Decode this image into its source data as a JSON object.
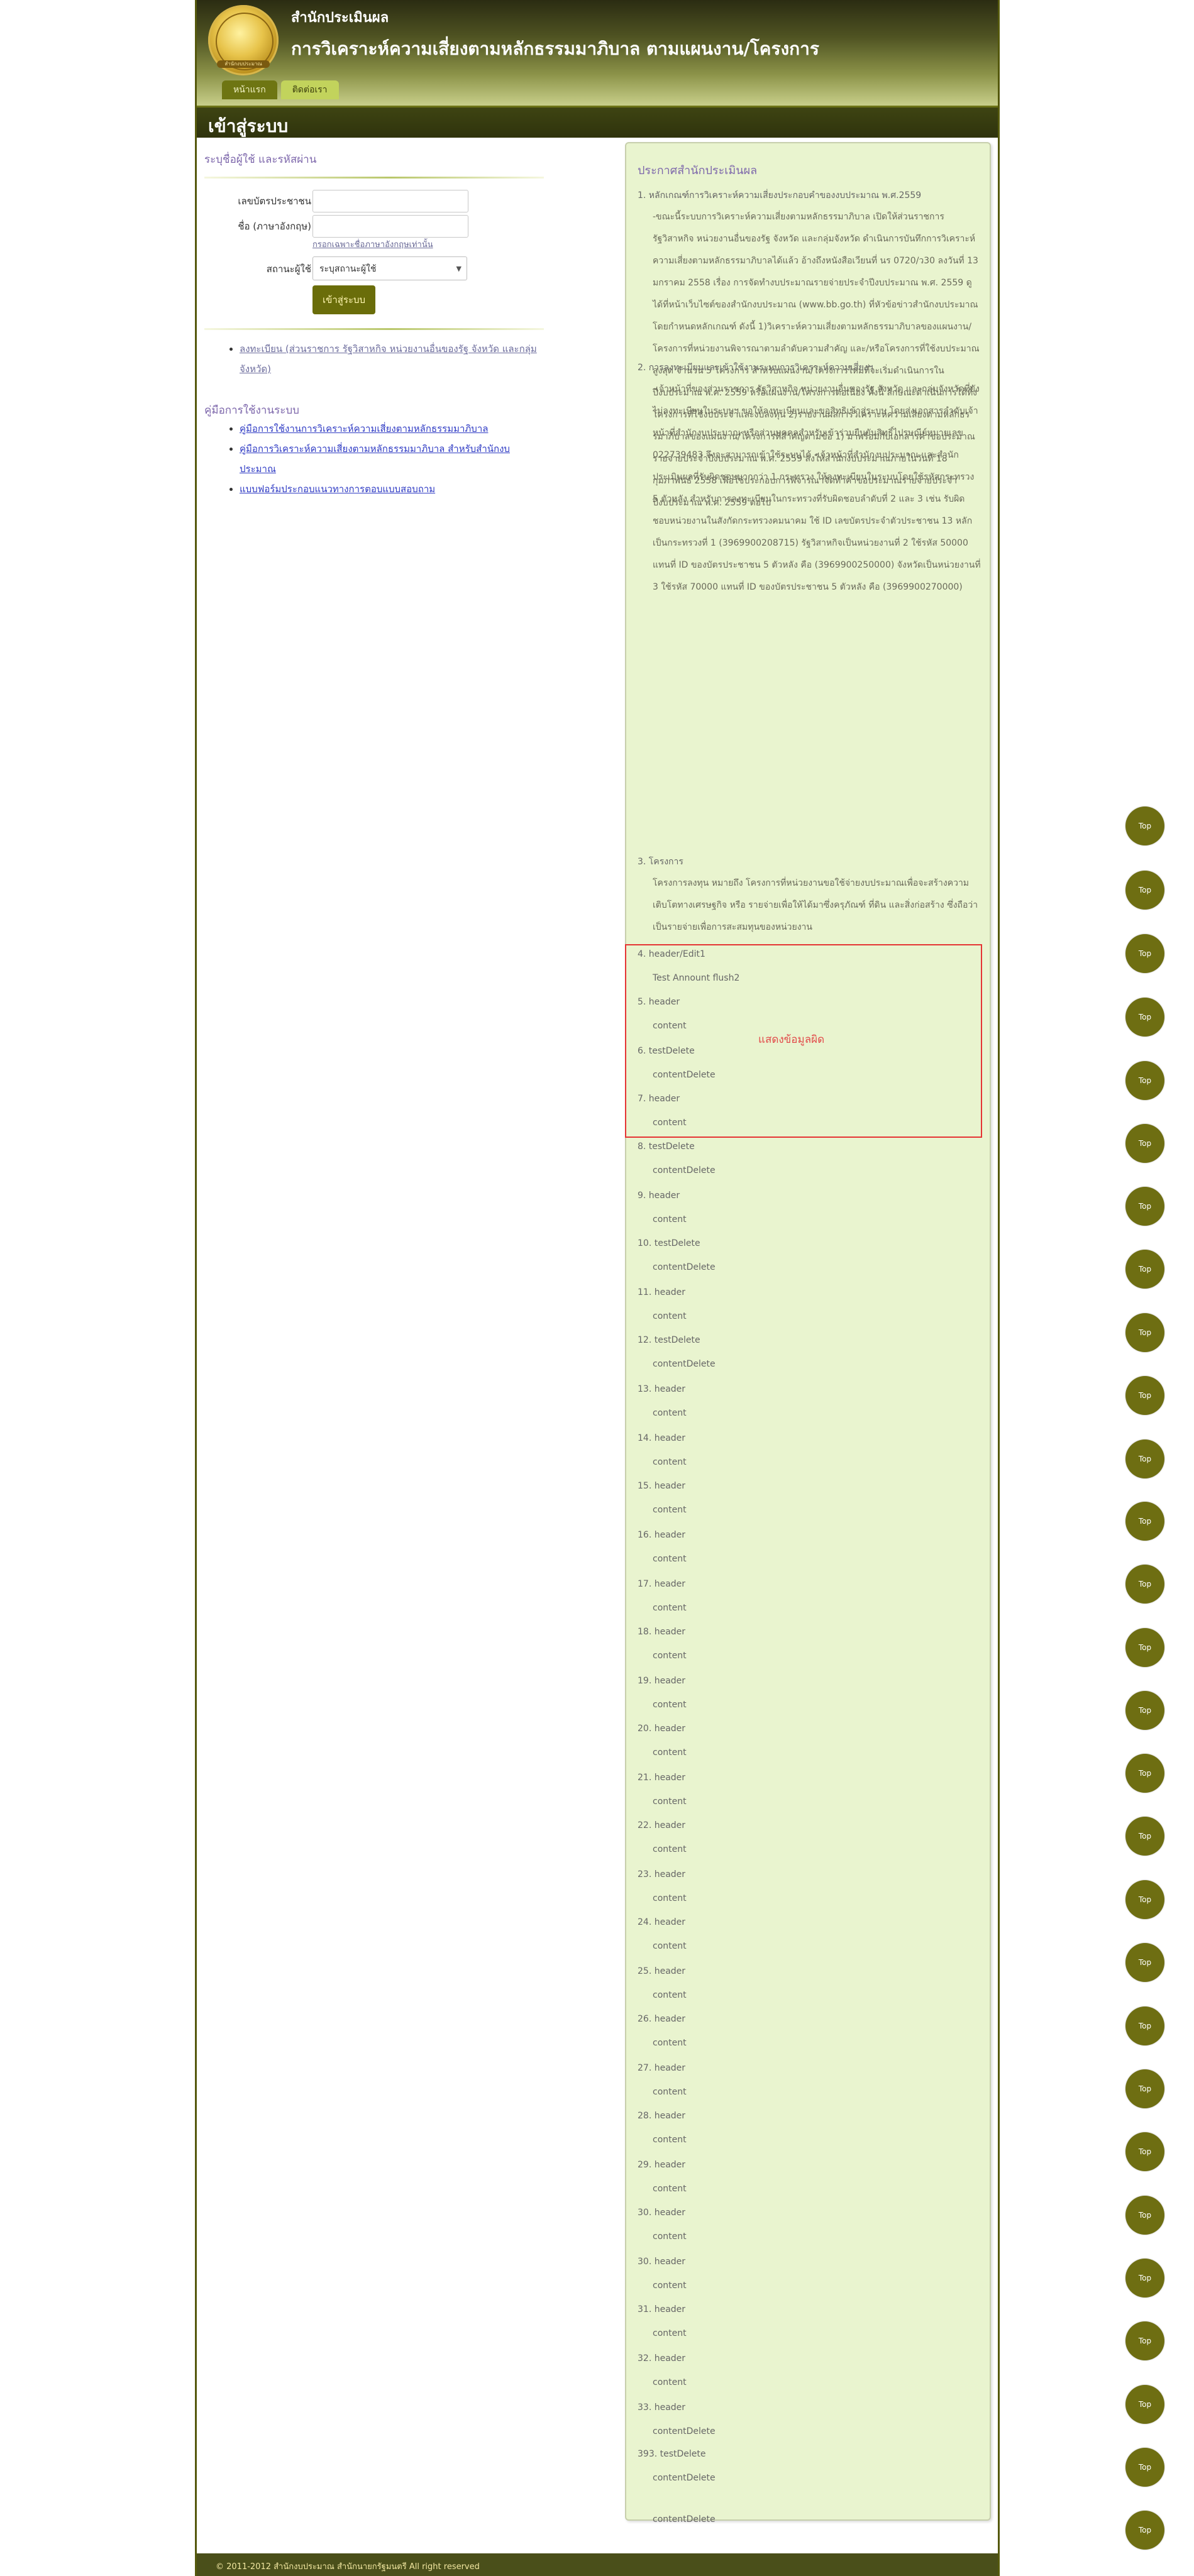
{
  "header": {
    "office_name": "สำนักประเมินผล",
    "system_title": "การวิเคราะห์ความเสี่ยงตามหลักธรรมมาภิบาล ตามแผนงาน/โครงการ",
    "logo_text": "สำนักงบประมาณ"
  },
  "nav": {
    "home": "หน้าแรก",
    "contact": "ติดต่อเรา"
  },
  "login_bar": {
    "label": "เข้าสู่ระบบ"
  },
  "login": {
    "heading": "ระบุชื่อผู้ใช้ และรหัสผ่าน",
    "id_label": "เลขบัตรประชาชน",
    "name_label": "ชื่อ (ภาษาอังกฤษ)",
    "name_hint": "กรอกเฉพาะชื่อภาษาอังกฤษเท่านั้น",
    "status_label": "สถานะผู้ใช้",
    "status_value": "ระบุสถานะผู้ใช้",
    "submit_label": "เข้าสู่ระบบ"
  },
  "register_links": [
    "ลงทะเบียน (ส่วนราชการ รัฐวิสาหกิจ หน่วยงานอื่นของรัฐ จังหวัด และกลุ่มจังหวัด)"
  ],
  "manual": {
    "heading": "คู่มือการใช้งานระบบ",
    "links": [
      "คู่มือการใช้งานการวิเคราะห์ความเสี่ยงตามหลักธรรมมาภิบาล",
      "คู่มือการวิเคราะห์ความเสี่ยงตามหลักธรรมมาภิบาล สำหรับสำนักงบประมาณ",
      "แบบฟอร์มประกอบแนวทางการตอบแบบสอบถาม"
    ]
  },
  "announcements": {
    "title": "ประกาศสำนักประเมินผล",
    "error_text": "แสดงข้อมูลผิด",
    "items": [
      {
        "title": "1. หลักเกณฑ์การวิเคราะห์ความเสี่ยงประกอบคำของงบประมาณ พ.ศ.2559",
        "content": "-ขณะนี้ระบบการวิเคราะห์ความเสี่ยงตามหลักธรรมาภิบาล เปิดให้ส่วนราชการ รัฐวิสาหกิจ หน่วยงานอื่นของรัฐ จังหวัด และกลุ่มจังหวัด ดำเนินการบันทึกการวิเคราะห์ความเสี่ยงตามหลักธรรมาภิบาลได้แล้ว อ้างถึงหนังสือเวียนที่ นร 0720/ว30 ลงวันที่ 13 มกราคม 2558 เรื่อง การจัดทำงบประมาณรายจ่ายประจำปีงบประมาณ พ.ศ. 2559 ดูได้ที่หน้าเว็บไซต์ของสำนักงบประมาณ (www.bb.go.th) ที่หัวข้อข่าวสำนักงบประมาณ โดยกำหนดหลักเกณฑ์ ดังนี้ 1)วิเคราะห์ความเสี่ยงตามหลักธรรมาภิบาลของแผนงาน/โครงการที่หน่วยงานพิจารณาตามลำดับความสำคัญ และ/หรือโครงการที่ใช้งบประมาณสูงสุด จำนวน 5 โครงการ สำหรับแผนงาน/โครงการใหม่ที่จะเริ่มดำเนินการในปีงบประมาณ พ.ศ. 2559 หรือแผนงาน/โครงการต่อเนื่อง ทั้งนี้ ลักษณะดำเนินการได้ทั้งโครงการที่ใช้งบประจำและงบลงทุน 2)รายงานผลการวิเคราะห์ความเสี่ยงตามหลักธรรมาภิบาลของแผนงาน/โครงการที่สำคัญตามข้อ 1) มาพร้อมกับเอกสารคำขอประมาณรายจ่ายประจำปีงบประมาณ พ.ศ. 2559 ส่งให้สำนักงบประมาณภายในวันที่ 18 กุมภาพันธ์ 2558 เพื่อใช้ประกอบการพิจารณาจัดทำคำขอประมาณรายจ่ายประจำปีงบประมาณ พ.ศ. 2559 ต่อไป"
      },
      {
        "title": "2. การลงทะเบียนและเข้าใช้งานระบบการวิเคราะห์ความเสี่ยงฯ",
        "content": "-เจ้าหน้าที่ของส่วนราชการ รัฐวิสาหกิจ หน่วยงานอื่นของรัฐ จังหวัด และกลุ่มจังหวัดที่ยังไม่ลงทะเบียนในระบบฯ ขอให้ลงทะเบียนและขอสิทธิเข้าสู่ระบบ โดยส่งเอกสารลำดับเจ้าหน้าที่สำนักงบประมาณ หรือส่วนบุคคลสำหรับเข้าร่วมยืนยันสิทธิ์ไปรษณีย์หมายเลข 022739483 จึงจะสามารถเข้าใช้ระบบได้ -เจ้าหน้าที่สำนักงบประมาณ และสำนักประเมินผลที่รับผิดชอบมากกว่า 1 กระทรวง ให้ลงทะเบียนในระบบโดยใช้รหัสกระทรวง 5 ตัวหลัง สำหรับการลงทะเบียนในกระทรวงที่รับผิดชอบลำดับที่ 2 และ 3 เช่น รับผิดชอบหน่วยงานในสังกัดกระทรวงคมนาคม ใช้ ID เลขบัตรประจำตัวประชาชน 13 หลัก เป็นกระทรวงที่ 1 (3969900208715) รัฐวิสาหกิจเป็นหน่วยงานที่ 2 ใช้รหัส 50000 แทนที่ ID ของบัตรประชาชน 5 ตัวหลัง คือ (3969900250000) จังหวัดเป็นหน่วยงานที่ 3 ใช้รหัส 70000 แทนที่ ID ของบัตรประชาชน 5 ตัวหลัง คือ (3969900270000)"
      },
      {
        "title": "3. โครงการ",
        "content": "โครงการลงทุน หมายถึง โครงการที่หน่วยงานขอใช้จ่ายงบประมาณเพื่อจะสร้างความเติบโตทางเศรษฐกิจ หรือ รายจ่ายเพื่อให้ได้มาซึ่งครุภัณฑ์ ที่ดิน และสิ่งก่อสร้าง ซึ่งถือว่าเป็นรายจ่ายเพื่อการสะสมทุนของหน่วยงาน"
      },
      {
        "title": "4. header/Edit1",
        "content": "Test Annount flush2"
      },
      {
        "title": "5. header",
        "content": "content"
      },
      {
        "title": "6. testDelete",
        "content": "contentDelete"
      },
      {
        "title": "7. header",
        "content": "content"
      },
      {
        "title": "8. testDelete",
        "content": "contentDelete"
      },
      {
        "title": "9. header",
        "content": "content"
      },
      {
        "title": "10. testDelete",
        "content": "contentDelete"
      },
      {
        "title": "11. header",
        "content": "content"
      },
      {
        "title": "12. testDelete",
        "content": "contentDelete"
      },
      {
        "title": "13. header",
        "content": "content"
      },
      {
        "title": "14. header",
        "content": "content"
      },
      {
        "title": "15. header",
        "content": "content"
      },
      {
        "title": "16. header",
        "content": "content"
      },
      {
        "title": "17. header",
        "content": "content"
      },
      {
        "title": "18. header",
        "content": "content"
      },
      {
        "title": "19. header",
        "content": "content"
      },
      {
        "title": "20. header",
        "content": "content"
      },
      {
        "title": "21. header",
        "content": "content"
      },
      {
        "title": "22. header",
        "content": "content"
      },
      {
        "title": "23. header",
        "content": "content"
      },
      {
        "title": "24. header",
        "content": "content"
      },
      {
        "title": "25. header",
        "content": "content"
      },
      {
        "title": "26. header",
        "content": "content"
      },
      {
        "title": "27. header",
        "content": "content"
      },
      {
        "title": "28. header",
        "content": "content"
      },
      {
        "title": "29. header",
        "content": "content"
      },
      {
        "title": "30. header",
        "content": "content"
      },
      {
        "title": "30. header",
        "content": "content"
      },
      {
        "title": "31. header",
        "content": "content"
      },
      {
        "title": "32. header",
        "content": "content"
      },
      {
        "title": "33. header",
        "content": "contentDelete"
      },
      {
        "title": "393. testDelete",
        "content": "contentDelete"
      },
      {
        "title": "",
        "content": "contentDelete"
      }
    ]
  },
  "top_button_label": "Top",
  "footer": {
    "text": "© 2011-2012 สำนักงบประมาณ สำนักนายกรัฐมนตรี All right reserved"
  },
  "colors": {
    "olive": "#6e6e12",
    "panel_bg": "#e9f4cf",
    "error_red": "#e53434",
    "heading_purple": "#7d67ab"
  }
}
